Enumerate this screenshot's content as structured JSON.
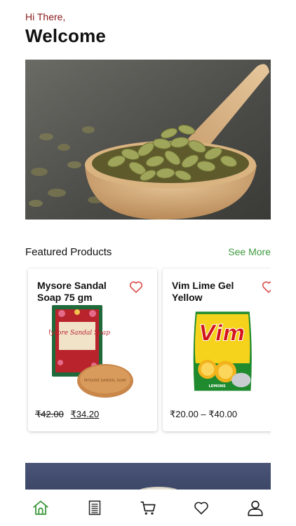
{
  "header": {
    "greeting": "Hi There,",
    "title": "Welcome"
  },
  "featured": {
    "section_title": "Featured Products",
    "see_more_label": "See More",
    "products": [
      {
        "name": "Mysore Sandal Soap 75 gm",
        "old_price": "₹42.00",
        "new_price": "₹34.20",
        "package_text": "Mysore Sandal Soap",
        "bar_text": "MYSORE SANDAL SOAP"
      },
      {
        "name": "Vim Lime Gel Yellow",
        "price_range": "₹20.00 – ₹40.00",
        "brand_text": "Vim",
        "pack_text": "LEMONS"
      }
    ]
  },
  "nav": {
    "items": [
      "home-icon",
      "list-icon",
      "cart-icon",
      "heart-icon",
      "profile-icon"
    ],
    "active_color": "#3f9a3f"
  },
  "colors": {
    "accent": "#3f9a3f",
    "greeting": "#8b1a1a",
    "favorite": "#d9534f"
  }
}
